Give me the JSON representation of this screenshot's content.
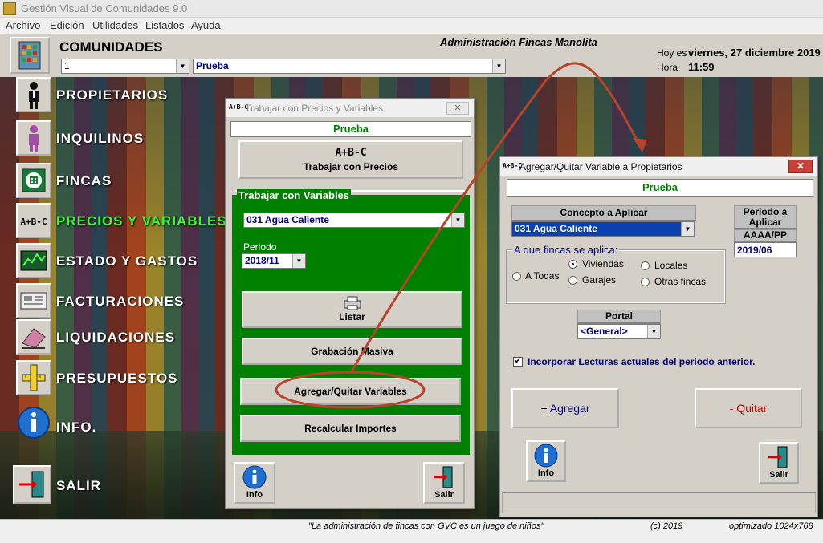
{
  "titlebar": {
    "title": "Gestión  Visual de Comunidades  9.0"
  },
  "menu": [
    "Archivo",
    "Edición",
    "Utilidades",
    "Listados",
    "Ayuda"
  ],
  "header": {
    "heading": "COMUNIDADES",
    "company": "Administración Fincas Manolita",
    "community_number": "1",
    "community_name": "Prueba",
    "date_label": "Hoy es",
    "date_value": "viernes, 27 diciembre 2019",
    "time_label": "Hora",
    "time_value": "11:59"
  },
  "nav": [
    {
      "label": "PROPIETARIOS",
      "icon": "person-icon"
    },
    {
      "label": "INQUILINOS",
      "icon": "tenant-icon"
    },
    {
      "label": "FINCAS",
      "icon": "building-icon"
    },
    {
      "label": "PRECIOS Y VARIABLES",
      "icon": "abc-icon",
      "active": true
    },
    {
      "label": "ESTADO  Y  GASTOS",
      "icon": "chart-icon"
    },
    {
      "label": "FACTURACIONES",
      "icon": "invoice-icon"
    },
    {
      "label": "LIQUIDACIONES",
      "icon": "eraser-icon"
    },
    {
      "label": "PRESUPUESTOS",
      "icon": "ruler-icon"
    },
    {
      "label": "INFO.",
      "icon": "info-icon"
    },
    {
      "label": "SALIR",
      "icon": "exit-icon"
    }
  ],
  "win1": {
    "title": "Trabajar con Precios y Variables",
    "name": "Prueba",
    "abc_glyph": "A+B-C",
    "precios_btn": "Trabajar con Precios",
    "group_title": "Trabajar con Variables",
    "variable": "031 Agua Caliente",
    "periodo_label": "Periodo",
    "periodo": "2018/11",
    "listar": "Listar",
    "grabacion": "Grabación Masiva",
    "agregar_quitar": "Agregar/Quitar Variables",
    "recalcular": "Recalcular Importes",
    "info": "Info",
    "salir": "Salir"
  },
  "win2": {
    "title": "Agregar/Quitar Variable a Propietarios",
    "abc_glyph": "A+B-C",
    "name": "Prueba",
    "concepto_label": "Concepto a Aplicar",
    "concepto": "031 Agua Caliente",
    "periodo_label": "Periodo a Aplicar",
    "periodo_format": "AAAA/PP",
    "periodo": "2019/06",
    "fincas_title": "A que fincas se aplica:",
    "opt_todas": "A Todas",
    "opt_viviendas": "Viviendas",
    "opt_garajes": "Garajes",
    "opt_locales": "Locales",
    "opt_otras": "Otras fincas",
    "portal_label": "Portal",
    "portal": "<General>",
    "checkbox": "Incorporar Lecturas actuales del periodo anterior.",
    "agregar": "+ Agregar",
    "quitar": "- Quitar",
    "info": "Info",
    "salir": "Salir"
  },
  "status": {
    "slogan": "\"La administración de fincas con GVC es un juego de niños\"",
    "copyright": "(c) 2019",
    "optimized": "optimizado 1024x768"
  },
  "colors": {
    "accent_green": "#008000",
    "active_nav": "#33ff33",
    "title_navy": "#000080",
    "quitar_red": "#c00000",
    "annotation": "#b5442a"
  }
}
